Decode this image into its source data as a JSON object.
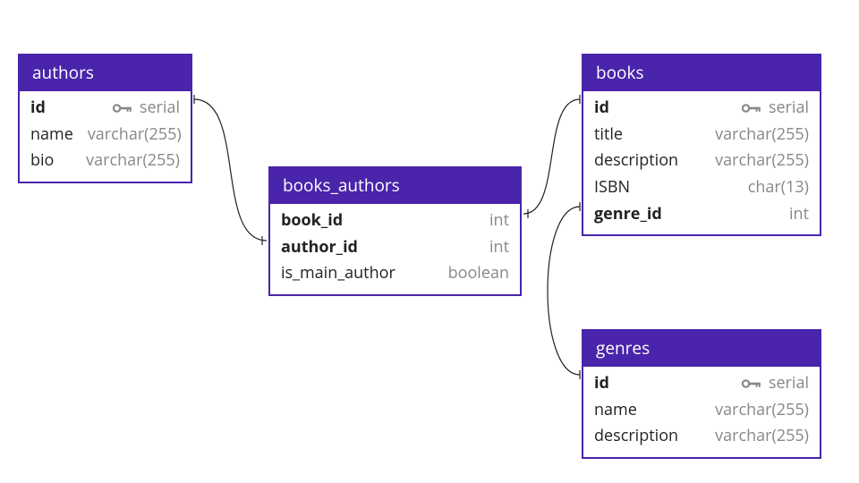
{
  "ui": {
    "tables": {
      "authors": {
        "title": "authors",
        "rows": {
          "id": {
            "name": "id",
            "type": "serial",
            "bold": true,
            "pk": true
          },
          "name": {
            "name": "name",
            "type": "varchar(255)",
            "bold": false,
            "pk": false
          },
          "bio": {
            "name": "bio",
            "type": "varchar(255)",
            "bold": false,
            "pk": false
          }
        }
      },
      "books_authors": {
        "title": "books_authors",
        "rows": {
          "book_id": {
            "name": "book_id",
            "type": "int",
            "bold": true,
            "pk": false
          },
          "author_id": {
            "name": "author_id",
            "type": "int",
            "bold": true,
            "pk": false
          },
          "is_main_author": {
            "name": "is_main_author",
            "type": "boolean",
            "bold": false,
            "pk": false
          }
        }
      },
      "books": {
        "title": "books",
        "rows": {
          "id": {
            "name": "id",
            "type": "serial",
            "bold": true,
            "pk": true
          },
          "title": {
            "name": "title",
            "type": "varchar(255)",
            "bold": false,
            "pk": false
          },
          "description": {
            "name": "description",
            "type": "varchar(255)",
            "bold": false,
            "pk": false
          },
          "ISBN": {
            "name": "ISBN",
            "type": "char(13)",
            "bold": false,
            "pk": false
          },
          "genre_id": {
            "name": "genre_id",
            "type": "int",
            "bold": true,
            "pk": false
          }
        }
      },
      "genres": {
        "title": "genres",
        "rows": {
          "id": {
            "name": "id",
            "type": "serial",
            "bold": true,
            "pk": true
          },
          "name": {
            "name": "name",
            "type": "varchar(255)",
            "bold": false,
            "pk": false
          },
          "description": {
            "name": "description",
            "type": "varchar(255)",
            "bold": false,
            "pk": false
          }
        }
      }
    }
  },
  "chart_data": {
    "type": "er-diagram",
    "entities": [
      {
        "name": "authors",
        "columns": [
          {
            "name": "id",
            "type": "serial",
            "pk": true
          },
          {
            "name": "name",
            "type": "varchar(255)",
            "pk": false
          },
          {
            "name": "bio",
            "type": "varchar(255)",
            "pk": false
          }
        ]
      },
      {
        "name": "books_authors",
        "columns": [
          {
            "name": "book_id",
            "type": "int",
            "fk": "books.id"
          },
          {
            "name": "author_id",
            "type": "int",
            "fk": "authors.id"
          },
          {
            "name": "is_main_author",
            "type": "boolean"
          }
        ]
      },
      {
        "name": "books",
        "columns": [
          {
            "name": "id",
            "type": "serial",
            "pk": true
          },
          {
            "name": "title",
            "type": "varchar(255)"
          },
          {
            "name": "description",
            "type": "varchar(255)"
          },
          {
            "name": "ISBN",
            "type": "char(13)"
          },
          {
            "name": "genre_id",
            "type": "int",
            "fk": "genres.id"
          }
        ]
      },
      {
        "name": "genres",
        "columns": [
          {
            "name": "id",
            "type": "serial",
            "pk": true
          },
          {
            "name": "name",
            "type": "varchar(255)"
          },
          {
            "name": "description",
            "type": "varchar(255)"
          }
        ]
      }
    ],
    "relationships": [
      {
        "from": "books_authors.author_id",
        "to": "authors.id"
      },
      {
        "from": "books_authors.book_id",
        "to": "books.id"
      },
      {
        "from": "books.genre_id",
        "to": "genres.id"
      }
    ]
  }
}
